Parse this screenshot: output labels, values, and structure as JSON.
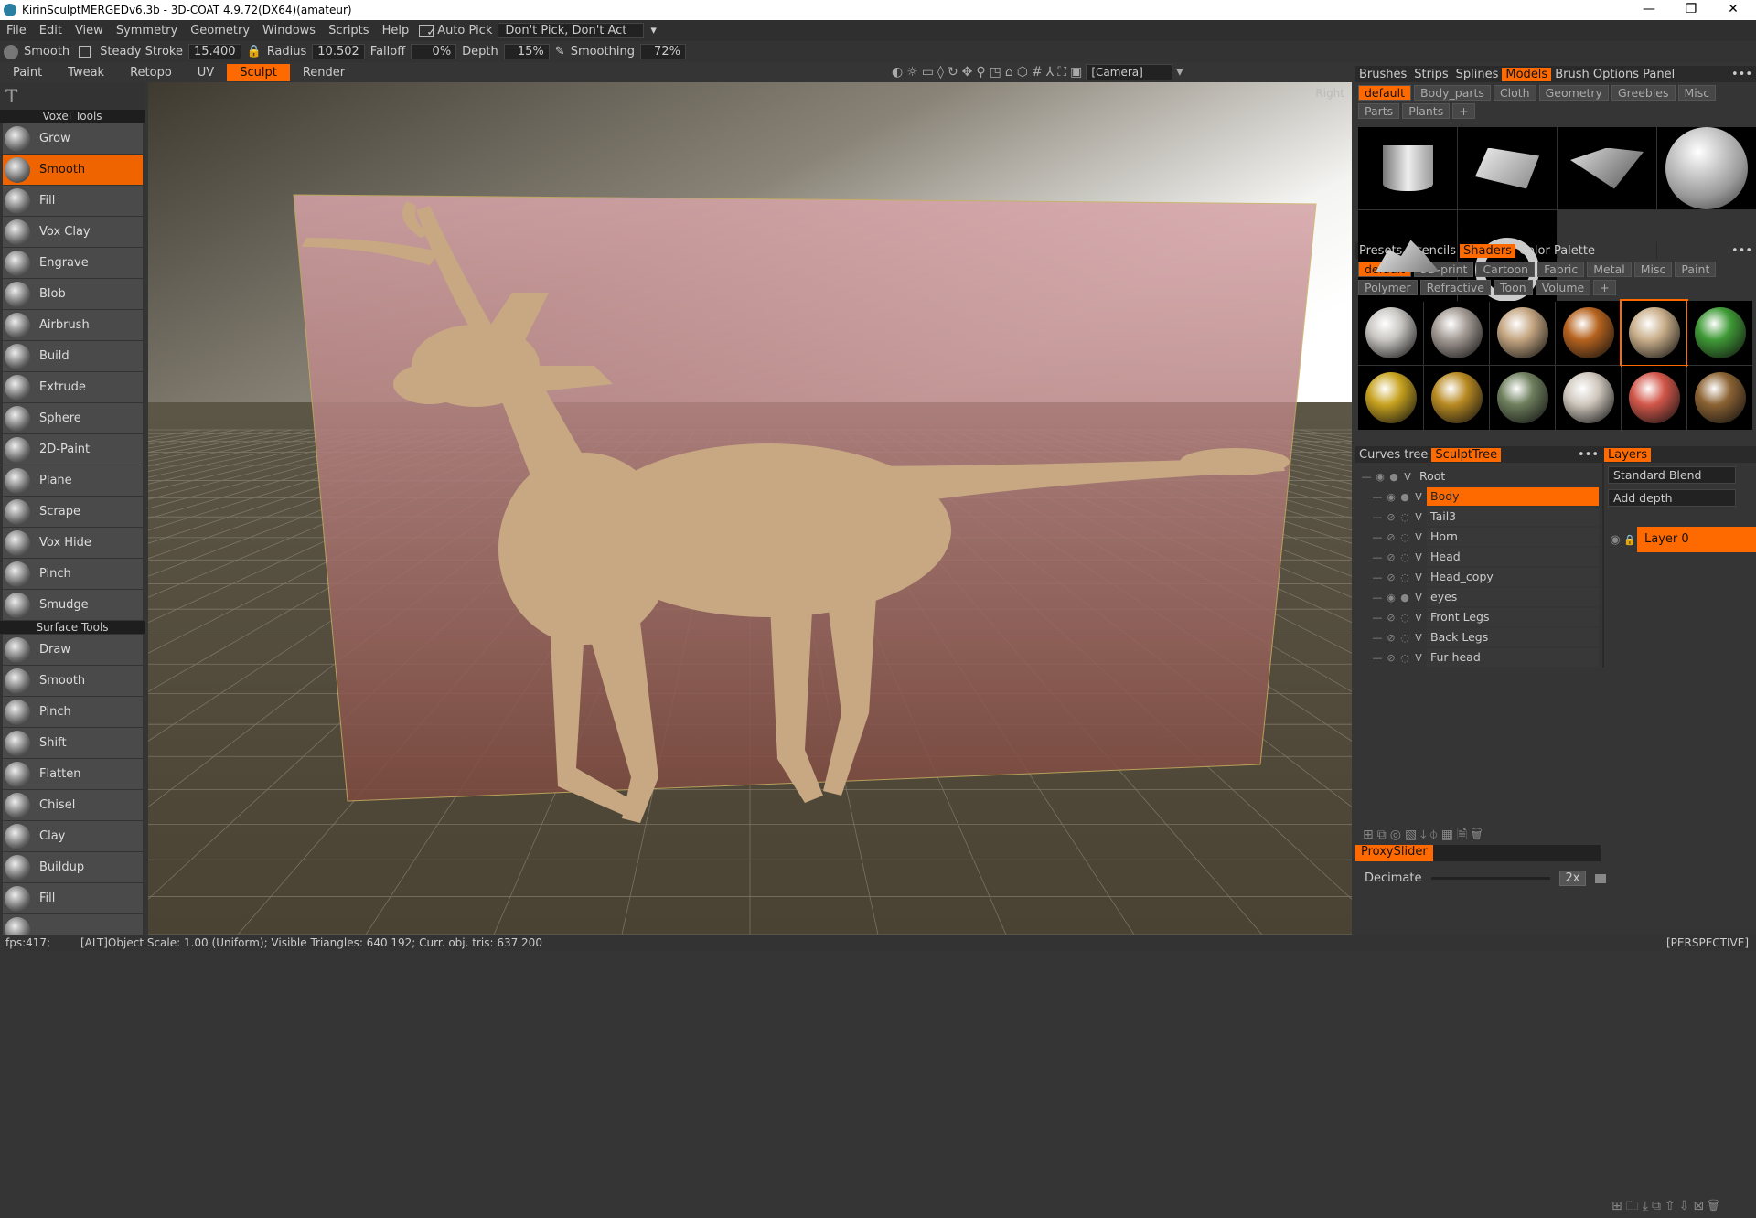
{
  "window": {
    "title": "KirinSculptMERGEDv6.3b - 3D-COAT 4.9.72(DX64)(amateur)",
    "minimize": "—",
    "maximize": "❐",
    "close": "✕"
  },
  "menu": {
    "items": [
      "File",
      "Edit",
      "View",
      "Symmetry",
      "Geometry",
      "Windows",
      "Scripts",
      "Help"
    ],
    "auto_pick": "Auto Pick",
    "pick_mode": "Don't Pick, Don't Act"
  },
  "options": {
    "tool": "Smooth",
    "steady_stroke": "Steady Stroke",
    "steady_value": "15.400",
    "radius": "Radius",
    "radius_value": "10.502",
    "falloff": "Falloff",
    "falloff_value": "0%",
    "depth": "Depth",
    "depth_value": "15%",
    "smoothing": "Smoothing",
    "smoothing_value": "72%"
  },
  "mode_tabs": [
    "Paint",
    "Tweak",
    "Retopo",
    "UV",
    "Sculpt",
    "Render"
  ],
  "active_mode": "Sculpt",
  "viewport": {
    "camera": "[Camera]",
    "view_label": "Right",
    "projection": "[PERSPECTIVE]"
  },
  "tools": {
    "voxel_header": "Voxel Tools",
    "voxel": [
      "Grow",
      "Smooth",
      "Fill",
      "Vox Clay",
      "Engrave",
      "Blob",
      "Airbrush",
      "Build",
      "Extrude",
      "Sphere",
      "2D-Paint",
      "Plane",
      "Scrape",
      "Vox Hide",
      "Pinch",
      "Smudge"
    ],
    "active": "Smooth",
    "surface_header": "Surface Tools",
    "surface": [
      "Draw",
      "Smooth",
      "Pinch",
      "Shift",
      "Flatten",
      "Chisel",
      "Clay",
      "Buildup",
      "Fill",
      ""
    ]
  },
  "models_panel": {
    "tabs": [
      "Brushes",
      "Strips",
      "Splines",
      "Models",
      "Brush Options Panel"
    ],
    "active_tab": "Models",
    "categories": [
      "default",
      "Body_parts",
      "Cloth",
      "Geometry",
      "Greebles",
      "Misc",
      "Parts",
      "Plants",
      "+"
    ],
    "active_category": "default"
  },
  "shaders_panel": {
    "tabs": [
      "Presets",
      "Stencils",
      "Shaders",
      "Color Palette"
    ],
    "active_tab": "Shaders",
    "categories": [
      "default",
      "3D-print",
      "Cartoon",
      "Fabric",
      "Metal",
      "Misc",
      "Paint",
      "Polymer",
      "Refractive",
      "Toon",
      "Volume",
      "+"
    ],
    "active_category": "default",
    "swatches": [
      "#c9c6c2",
      "#a39a94",
      "#c4a581",
      "#b5621e",
      "#c9ae8a",
      "#3f9a36",
      "#c7a21f",
      "#b88a22",
      "#6e7f5d",
      "#cfc7bd",
      "#d2574a",
      "#8b6233"
    ],
    "selected_index": 4
  },
  "tree_panel": {
    "tabs": [
      "Curves tree",
      "SculptTree"
    ],
    "active_tab": "SculptTree",
    "rows": [
      {
        "name": "Root",
        "visible": true
      },
      {
        "name": "Body",
        "visible": true,
        "selected": true
      },
      {
        "name": "Tail3",
        "visible": false
      },
      {
        "name": "Horn",
        "visible": false
      },
      {
        "name": "Head",
        "visible": false
      },
      {
        "name": "Head_copy",
        "visible": false
      },
      {
        "name": "eyes",
        "visible": true
      },
      {
        "name": "Front Legs",
        "visible": false
      },
      {
        "name": "Back Legs",
        "visible": false
      },
      {
        "name": "Fur head",
        "visible": false
      }
    ]
  },
  "layers_panel": {
    "tab": "Layers",
    "blend": "Standard Blend",
    "depth_mode": "Add depth",
    "layer": "Layer 0"
  },
  "proxy": {
    "tab": "ProxySlider",
    "label": "Decimate",
    "value": "2x"
  },
  "status": {
    "fps": "fps:417;",
    "info": "[ALT]Object Scale: 1.00 (Uniform); Visible Triangles: 640 192; Curr. obj. tris: 637 200"
  },
  "accent": "#ff6a00"
}
